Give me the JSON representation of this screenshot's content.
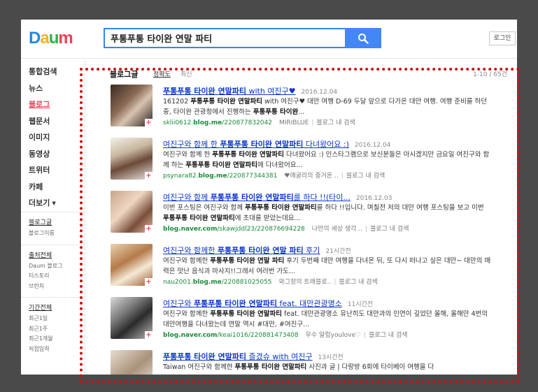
{
  "header": {
    "logo_letters": [
      {
        "ch": "D",
        "color": "#1f8ae7"
      },
      {
        "ch": "a",
        "color": "#f0b32a"
      },
      {
        "ch": "u",
        "color": "#2cb34a"
      },
      {
        "ch": "m",
        "color": "#e8425a"
      }
    ],
    "search_value": "푸통푸통 타이완 연말 파티",
    "search_icon": "search-icon",
    "login_label": "로그인"
  },
  "sidebar": {
    "nav": [
      "통합검색",
      "뉴스",
      "블로그",
      "웹문서",
      "이미지",
      "동영상",
      "트위터",
      "카페",
      "더보기"
    ],
    "active_index": 2,
    "more_caret": "▼",
    "groups": [
      {
        "head": "블로그글",
        "subs": [
          "블로그이름"
        ]
      },
      {
        "head": "출처전체",
        "subs": [
          "Daum 블로그",
          "티스토리",
          "브런치"
        ]
      },
      {
        "head": "기간전체",
        "subs": [
          "최근1일",
          "최근1주",
          "최근1개월",
          "직접입력"
        ]
      }
    ]
  },
  "section": {
    "title": "블로그글",
    "sort_accuracy": "정확도",
    "sort_latest": "최신",
    "count": "1-10 / 65건"
  },
  "results": [
    {
      "title_pre": "",
      "title_bold": "푸통푸통 타이완 연말파티",
      "title_post": " with 여진구♥",
      "date": "2016.12.04",
      "snippet": [
        [
          "161202 ",
          false
        ],
        [
          "푸통푸통 타이완 연말파티",
          true
        ],
        [
          " with 여진구♥ 대만 여행 D-69 두달 앞으로 다가온 대만 여행. 여행 준비를 하던 중, 타이완 관광청에서 진행하는 ",
          false
        ],
        [
          "푸통푸통 타이완",
          true
        ],
        [
          "...",
          false
        ]
      ],
      "url_pre": "sklii0612.",
      "url_bold": "blog.me",
      "url_post": "/220877832042",
      "blog_name": "MIRIBLUE",
      "blog_search": "블로그 내 검색"
    },
    {
      "title_pre": "여진구와 함께 한 ",
      "title_bold": "푸통푸통 타이완 연말파티",
      "title_post": " 다녀왔어요 :)",
      "date": "2016.12.04",
      "snippet": [
        [
          "여진구와 함께 한 ",
          false
        ],
        [
          "푸통푸통 타이완 연말파티",
          true
        ],
        [
          " 다녀왔어요 :) 인스타그램으로 보신분들은 아시겠지만 금요일 여진구와 함께 하는 ",
          false
        ],
        [
          "푸통푸통 타이완 연말파티",
          true
        ],
        [
          "에 다녀왔어요...",
          false
        ]
      ],
      "url_pre": "psynara82.",
      "url_bold": "blog.me",
      "url_post": "/220877344381",
      "blog_name": "♥애굴리의 중거운 ..",
      "blog_search": "블로그 내 검색"
    },
    {
      "title_pre": "여진구와 함께 ",
      "title_bold": "푸통푸통 타이완 연말파티",
      "title_post": "를 하다 !!(타이...",
      "date": "2016.12.03",
      "snippet": [
        [
          "이번 포스팅은 여진구와 함께 ",
          false
        ],
        [
          "푸통푸통 타이완 연말파티",
          true
        ],
        [
          "를 하다 !!입니다. 며칠전 저의 대만 여행 포스팅을 보고 이번 ",
          false
        ],
        [
          "푸통푸통 타이완 연말파티",
          true
        ],
        [
          "에 초대를 받았는데요...",
          false
        ]
      ],
      "url_pre": "",
      "url_bold": "blog.naver.com",
      "url_post": "/skawjddl23/220876694228",
      "blog_name": "나만의 세상 생각 ..",
      "blog_search": "블로그 내 검색"
    },
    {
      "title_pre": "여진구와 함께한 ",
      "title_bold": "푸통푸통 타이완 연말 파티",
      "title_post": " 후기",
      "date": "21시간전",
      "snippet": [
        [
          "여진구와 함께한 ",
          false
        ],
        [
          "푸통푸통 타이완 연말 파티",
          true
        ],
        [
          " 후기 두번째 대만 여행을 다녀온 뒤, 또 다시 떠나고 싶은 대만~ 대만의 매력은 맛난 음식과 마사지!!그래서 여러번 가도...",
          false
        ]
      ],
      "url_pre": "nau2001.",
      "url_bold": "blog.me",
      "url_post": "/220881025055",
      "blog_name": "와그장의 트래블로..",
      "blog_search": "블로그 내 검색"
    },
    {
      "title_pre": "여진구와 ",
      "title_bold": "푸통푸통 타이완 연말파티",
      "title_post": " feat. 대만관광명소",
      "date": "11시간전",
      "snippet": [
        [
          "여진구와 함께한 ",
          false
        ],
        [
          "푸통푸통 타이완 연말파티",
          true
        ],
        [
          " feat. 대만관광명소 유난히도 대만과의 인연이 깊었던 올해, 올해만 4번의 대만여행을 다녀왔는데 연말 역시 #대만, #여진구...",
          false
        ]
      ],
      "url_pre": "",
      "url_bold": "blog.naver.com",
      "url_post": "/keai1016/220881473408",
      "blog_name": "우수 알럽youlove♡",
      "blog_search": "블로그 내 검색"
    },
    {
      "title_pre": "",
      "title_bold": "푸통푸통 타이완 연말파티",
      "title_post": " 즐겼슈 with 여진구",
      "date": "13시간전",
      "snippet": [
        [
          "Taiwan 여진구와 함께한 ",
          false
        ],
        [
          "푸통푸통 타이완 연말파티",
          true
        ],
        [
          " 사진과 글 | 다랑방 6회에 타이베이 여행을 다",
          false
        ]
      ],
      "url_pre": "",
      "url_bold": "",
      "url_post": "",
      "blog_name": "",
      "blog_search": ""
    }
  ]
}
